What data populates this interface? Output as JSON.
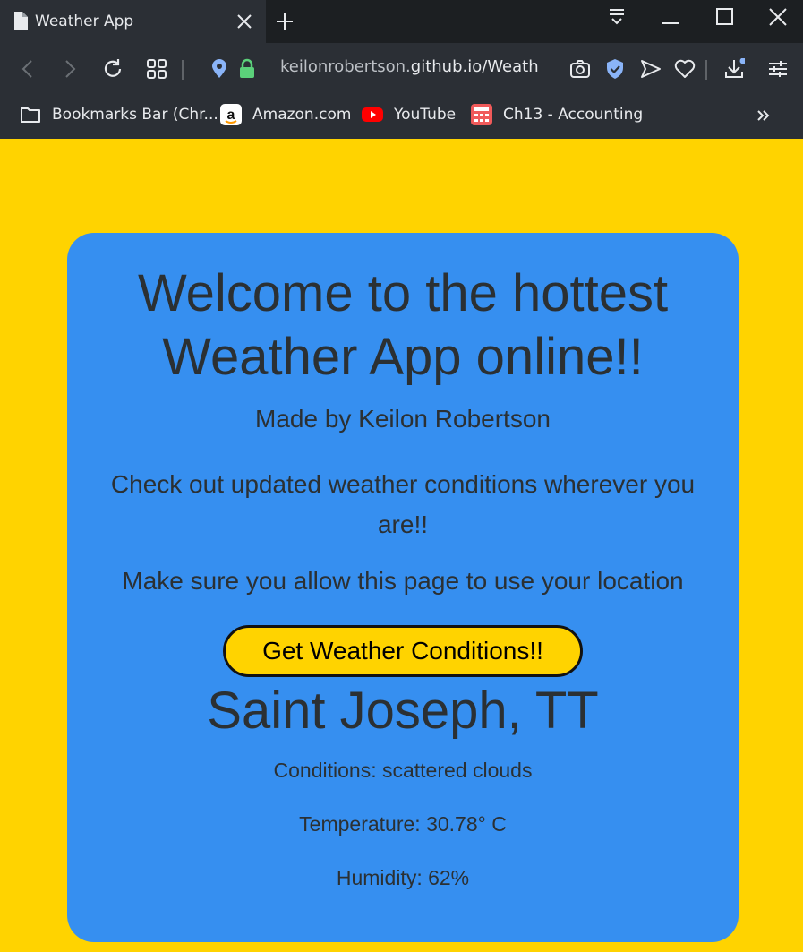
{
  "browser": {
    "tab_title": "Weather App",
    "url_host": "keilonrobertson.",
    "url_domain": "github.io",
    "url_path": "/Weath",
    "bookmarks": [
      {
        "label": "Bookmarks Bar (Chr...",
        "icon": "folder-icon"
      },
      {
        "label": "Amazon.com",
        "icon": "amazon-icon"
      },
      {
        "label": "YouTube",
        "icon": "youtube-icon"
      },
      {
        "label": "Ch13 - Accounting",
        "icon": "calculator-icon"
      }
    ]
  },
  "page": {
    "headline": "Welcome to the hottest Weather App online!!",
    "subtitle": "Made by Keilon Robertson",
    "intro": "Check out updated weather conditions wherever you are!!",
    "location_note": "Make sure you allow this page to use your location",
    "button_label": "Get Weather Conditions!!",
    "city": "Saint Joseph, TT",
    "conditions": "Conditions: scattered clouds",
    "temperature": "Temperature: 30.78° C",
    "humidity": "Humidity: 62%"
  },
  "colors": {
    "page_background": "#ffd300",
    "card_background": "#368ff0",
    "button_background": "#ffd300",
    "text": "#2b3033"
  }
}
